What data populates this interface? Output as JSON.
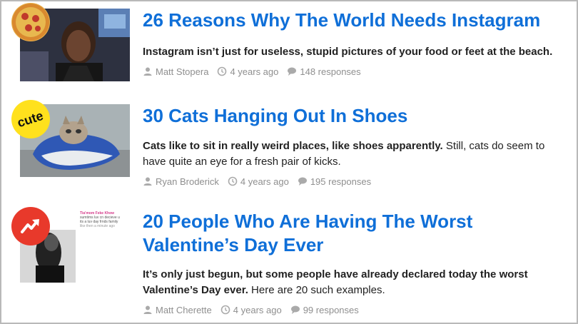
{
  "articles": [
    {
      "title": "26 Reasons Why The World Needs Instagram",
      "desc_bold": "Instagram isn’t just for useless, stupid pictures of your food or feet at the beach.",
      "desc_rest": "",
      "author": "Matt Stopera",
      "time": "4 years ago",
      "responses": "148 responses",
      "badge": "pizza-icon"
    },
    {
      "title": "30 Cats Hanging Out In Shoes",
      "desc_bold": "Cats like to sit in really weird places, like shoes apparently.",
      "desc_rest": " Still, cats do seem to have quite an eye for a fresh pair of kicks.",
      "author": "Ryan Broderick",
      "time": "4 years ago",
      "responses": "195 responses",
      "badge": "cute",
      "badge_text": "cute"
    },
    {
      "title": "20 People Who Are Having The Worst Valentine’s Day Ever",
      "desc_bold": "It’s only just begun, but some people have already declared today the worst Valentine’s Day ever.",
      "desc_rest": " Here are 20 such examples.",
      "author": "Matt Cherette",
      "time": "4 years ago",
      "responses": "99 responses",
      "badge": "trending-arrow-icon",
      "thumb_text": {
        "line1": "Tia'mom Feke Khow",
        "line2": "sumtims luv cn decieve u",
        "line3": "its a luv day frnds family",
        "line4": "like  then a minute ago"
      }
    }
  ],
  "colors": {
    "title": "#0f6fd8",
    "meta": "#8f8f8f",
    "badge_red": "#e8392b",
    "badge_yellow": "#ffe11d"
  }
}
